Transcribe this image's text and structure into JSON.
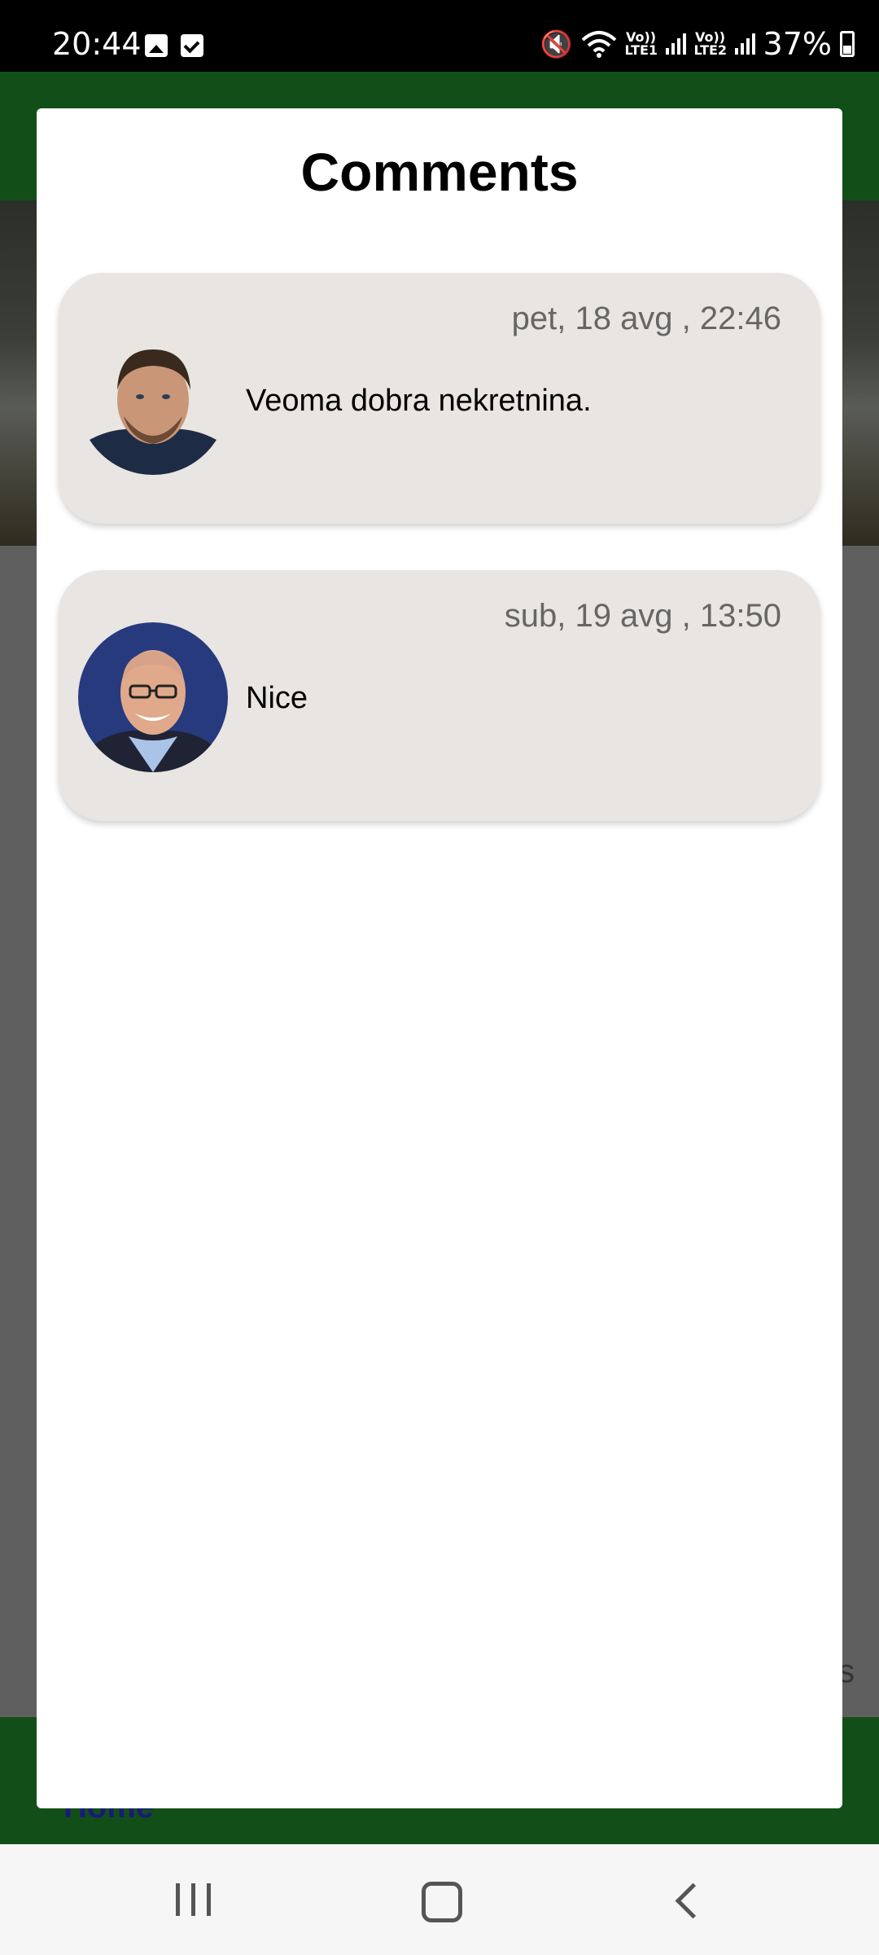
{
  "status_bar": {
    "time": "20:44",
    "network_label_1": "Vo)) LTE1",
    "network_label_2": "Vo)) LTE2",
    "battery": "37%"
  },
  "background": {
    "home_label": "Home",
    "partial_text": "s"
  },
  "dialog": {
    "title": "Comments",
    "comments": [
      {
        "date": "pet, 18 avg , 22:46",
        "text": "Veoma dobra nekretnina.",
        "avatar": "user-avatar-1"
      },
      {
        "date": "sub, 19 avg , 13:50",
        "text": "Nice",
        "avatar": "user-avatar-2"
      }
    ]
  },
  "colors": {
    "header_green": "#124f18",
    "card_background": "#e8e5e2",
    "date_text": "#666666"
  }
}
